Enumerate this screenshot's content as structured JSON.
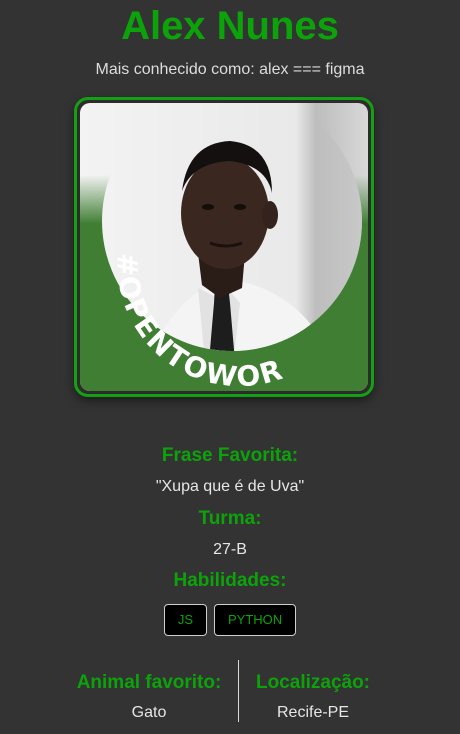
{
  "profile": {
    "name": "Alex Nunes",
    "subtitle": "Mais conhecido como: alex === figma",
    "badge_text": "#OPENTOWORK"
  },
  "sections": {
    "frase": {
      "label": "Frase Favorita:",
      "value": "\"Xupa que é de Uva\""
    },
    "turma": {
      "label": "Turma:",
      "value": "27-B"
    },
    "habilidades": {
      "label": "Habilidades:",
      "items": [
        "JS",
        "PYTHON"
      ]
    }
  },
  "details": {
    "animal": {
      "label": "Animal favorito:",
      "value": "Gato"
    },
    "localizacao": {
      "label": "Localização:",
      "value": "Recife-PE"
    }
  },
  "colors": {
    "background": "#333333",
    "accent": "#0ca30a",
    "badge_green": "#3f7e33",
    "text": "#e6e6e6"
  }
}
